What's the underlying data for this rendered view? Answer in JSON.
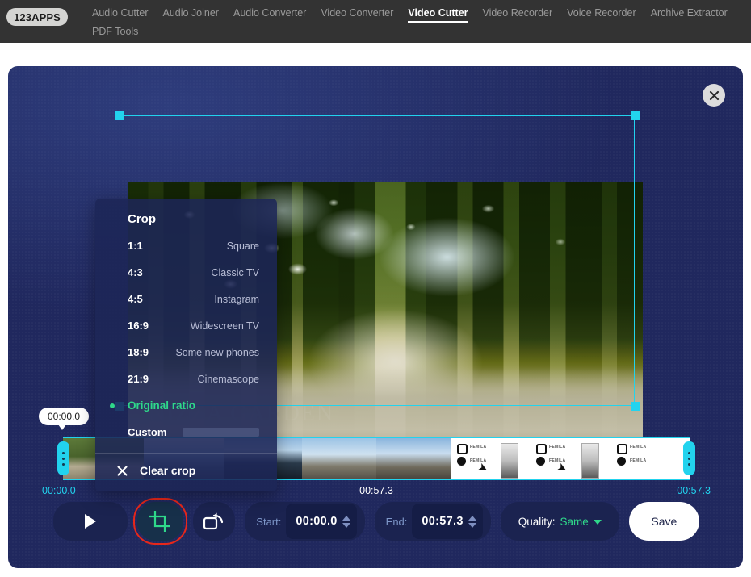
{
  "header": {
    "logo": "123APPS",
    "nav": [
      {
        "label": "Audio Cutter",
        "active": false
      },
      {
        "label": "Audio Joiner",
        "active": false
      },
      {
        "label": "Audio Converter",
        "active": false
      },
      {
        "label": "Video Converter",
        "active": false
      },
      {
        "label": "Video Cutter",
        "active": true
      },
      {
        "label": "Video Recorder",
        "active": false
      },
      {
        "label": "Voice Recorder",
        "active": false
      },
      {
        "label": "Archive Extractor",
        "active": false
      },
      {
        "label": "PDF Tools",
        "active": false
      }
    ]
  },
  "panel": {
    "close_icon": "close-icon",
    "background_color": "#20285e"
  },
  "video": {
    "watermark": "NIZZA GARDEN",
    "crop_handle_color": "#22d3ee"
  },
  "crop_menu": {
    "title": "Crop",
    "options": [
      {
        "ratio": "1:1",
        "name": "Square",
        "selected": false
      },
      {
        "ratio": "4:3",
        "name": "Classic TV",
        "selected": false
      },
      {
        "ratio": "4:5",
        "name": "Instagram",
        "selected": false
      },
      {
        "ratio": "16:9",
        "name": "Widescreen TV",
        "selected": false
      },
      {
        "ratio": "18:9",
        "name": "Some new phones",
        "selected": false
      },
      {
        "ratio": "21:9",
        "name": "Cinemascope",
        "selected": false
      },
      {
        "ratio": "Original ratio",
        "name": "",
        "selected": true
      },
      {
        "ratio": "Custom",
        "name": "",
        "selected": false
      }
    ],
    "clear_label": "Clear crop",
    "clear_icon": "close-icon",
    "accent_color": "#2fd88a"
  },
  "timeline": {
    "tooltip": "00:00.0",
    "start_label": "00:00.0",
    "mid_label": "00:57.3",
    "end_label": "00:57.3",
    "instagram_watermark": "FEMILA"
  },
  "toolbar": {
    "play_icon": "play-icon",
    "crop_icon": "crop-icon",
    "rotate_icon": "rotate-icon",
    "start_label": "Start:",
    "start_value": "00:00.0",
    "end_label": "End:",
    "end_value": "00:57.3",
    "quality_label": "Quality:",
    "quality_value": "Same",
    "save_label": "Save",
    "highlight_color": "#e8271a"
  }
}
